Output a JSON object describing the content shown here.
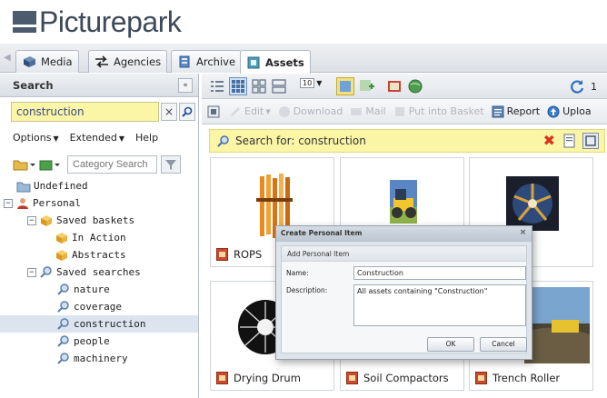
{
  "app": {
    "logo_text": "Picturepark"
  },
  "tabs": [
    {
      "label": "Media",
      "icon": "media-icon"
    },
    {
      "label": "Agencies",
      "icon": "agencies-icon"
    },
    {
      "label": "Archive",
      "icon": "archive-icon"
    },
    {
      "label": "Assets",
      "icon": "assets-icon",
      "active": true
    }
  ],
  "sidebar": {
    "title": "Search",
    "collapse_label": "«",
    "search_value": "construction",
    "clear_glyph": "×",
    "options": [
      "Options",
      "Extended",
      "Help"
    ],
    "category_placeholder": "Category Search",
    "tree": [
      {
        "label": "Undefined",
        "level": 0,
        "icon": "folder-icon"
      },
      {
        "label": "Personal",
        "level": 0,
        "icon": "user-icon",
        "expanded": true
      },
      {
        "label": "Saved baskets",
        "level": 1,
        "icon": "basket-icon",
        "expanded": true
      },
      {
        "label": "In Action",
        "level": 2,
        "icon": "basket-icon"
      },
      {
        "label": "Abstracts",
        "level": 2,
        "icon": "basket-icon"
      },
      {
        "label": "Saved searches",
        "level": 1,
        "icon": "search-icon",
        "expanded": true
      },
      {
        "label": "nature",
        "level": 2,
        "icon": "search-icon"
      },
      {
        "label": "coverage",
        "level": 2,
        "icon": "search-icon"
      },
      {
        "label": "construction",
        "level": 2,
        "icon": "search-icon",
        "selected": true
      },
      {
        "label": "people",
        "level": 2,
        "icon": "search-icon"
      },
      {
        "label": "machinery",
        "level": 2,
        "icon": "search-icon"
      }
    ]
  },
  "toolbar": {
    "page_size": "10",
    "refresh_label": "1",
    "actions": [
      {
        "label": "Edit",
        "enabled": false
      },
      {
        "label": "Download",
        "enabled": false
      },
      {
        "label": "Mail",
        "enabled": false
      },
      {
        "label": "Put into Basket",
        "enabled": false
      },
      {
        "label": "Report",
        "enabled": true
      },
      {
        "label": "Uploa",
        "enabled": true
      }
    ]
  },
  "search_bar": {
    "text": "Search for: construction"
  },
  "assets": [
    {
      "name": "ROPS",
      "thumb": "rops"
    },
    {
      "name": "",
      "thumb": "roller"
    },
    {
      "name": "",
      "thumb": "drum"
    },
    {
      "name": "Drying Drum",
      "thumb": "drying"
    },
    {
      "name": "Soil Compactors",
      "thumb": "soil"
    },
    {
      "name": "Trench Roller",
      "thumb": "trench"
    }
  ],
  "dialog": {
    "title": "Create Personal Item",
    "section": "Add Personal Item",
    "name_label": "Name:",
    "name_value": "Construction",
    "description_label": "Description:",
    "description_value": "All assets containing \"Construction\"",
    "ok_label": "OK",
    "cancel_label": "Cancel",
    "close_glyph": "×"
  },
  "colors": {
    "highlight": "#fbf6a6",
    "selection": "#dbe4ef",
    "accent": "#3e4a58"
  }
}
